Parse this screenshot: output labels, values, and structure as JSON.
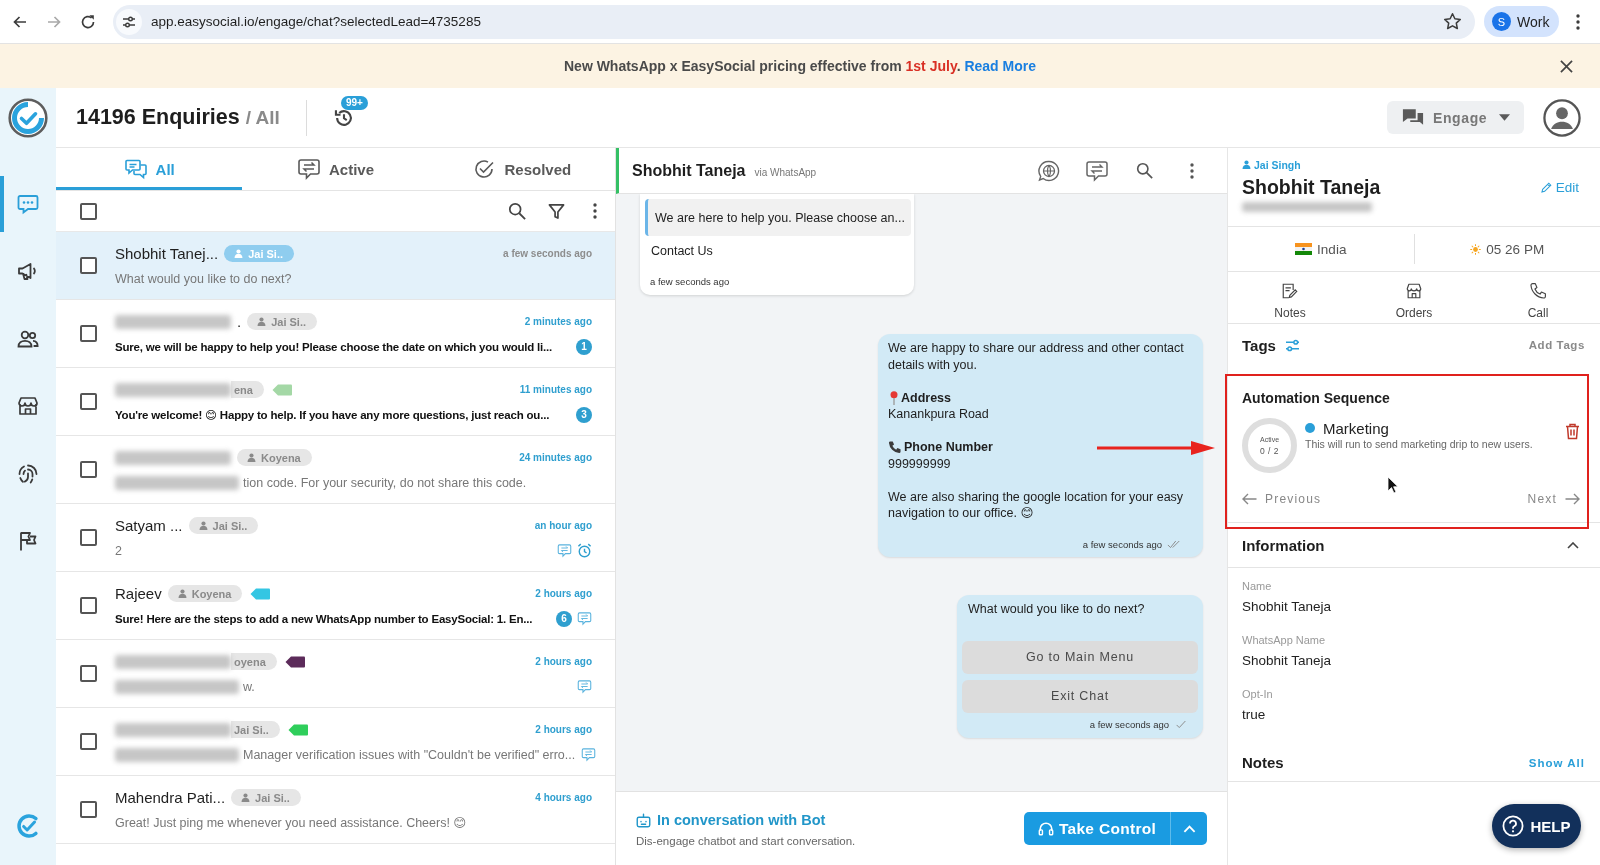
{
  "browser": {
    "url": "app.easysocial.io/engage/chat?selectedLead=4735285",
    "profile_initial": "S",
    "profile_name": "Work"
  },
  "banner": {
    "text": "New WhatsApp x EasySocial pricing effective from",
    "highlight": "1st July",
    "end": ".",
    "link": "Read More"
  },
  "rail": {
    "items": [
      {
        "kind": "chat",
        "selected": true
      },
      {
        "kind": "megaphone",
        "selected": false
      },
      {
        "kind": "people",
        "selected": false
      },
      {
        "kind": "store",
        "selected": false
      },
      {
        "kind": "fingerprint",
        "selected": false
      },
      {
        "kind": "flag",
        "selected": false
      }
    ]
  },
  "header": {
    "title": "14196 Enquiries",
    "scope": "/ All",
    "history_badge": "99+",
    "engage": "Engage"
  },
  "tabs": [
    {
      "kind": "all",
      "label": "All",
      "selected": true
    },
    {
      "kind": "active",
      "label": "Active",
      "selected": false
    },
    {
      "kind": "resolved",
      "label": "Resolved",
      "selected": false
    }
  ],
  "list_toolbar": {
    "select_all": {
      "checked": false
    }
  },
  "conversations": [
    {
      "name": "Shobhit Tanej...",
      "name_redacted": false,
      "agent": "Jai Si..",
      "agent_icon": true,
      "time": "a few seconds ago",
      "preview": "What would you like to do next?",
      "preview_redacted": false,
      "unread": false,
      "checked": false,
      "selected": true
    },
    {
      "name": ".",
      "name_redacted": true,
      "agent": "Jai Si..",
      "agent_icon": true,
      "time": "2 minutes ago",
      "preview": "Sure, we will be happy to help you! Please choose the date on which you would li...",
      "preview_redacted": false,
      "unread": true,
      "badge": "1",
      "checked": false,
      "selected": false
    },
    {
      "name_redacted": true,
      "agent": "ena",
      "agent_icon": false,
      "tag": {
        "color": "#a4d8a6"
      },
      "time": "11 minutes ago",
      "preview": "You're welcome! 😊 Happy to help. If you have any more questions, just reach ou...",
      "preview_redacted": false,
      "unread": true,
      "badge": "3",
      "checked": false,
      "selected": false
    },
    {
      "name_redacted": true,
      "agent": "Koyena",
      "agent_icon": true,
      "time": "24 minutes ago",
      "preview": "tion code. For your security, do not share this code.",
      "preview_redacted": true,
      "unread": false,
      "checked": false,
      "selected": false
    },
    {
      "name": "Satyam ...",
      "name_redacted": false,
      "agent": "Jai Si..",
      "agent_icon": true,
      "time": "an hour ago",
      "preview": "2",
      "preview_redacted": false,
      "unread": false,
      "status_icons": [
        {
          "kind": "chat"
        },
        {
          "kind": "alarm"
        }
      ],
      "checked": false,
      "selected": false
    },
    {
      "name": "Rajeev",
      "name_redacted": false,
      "agent": "Koyena",
      "agent_icon": true,
      "tag": {
        "color": "#34c6e3"
      },
      "time": "2 hours ago",
      "preview": "Sure! Here are the steps to add a new WhatsApp number to EasySocial: 1. En...",
      "preview_redacted": false,
      "unread": true,
      "badge": "6",
      "status_icons": [
        {
          "kind": "chat"
        }
      ],
      "checked": false,
      "selected": false
    },
    {
      "name_redacted": true,
      "agent": "oyena",
      "agent_icon": false,
      "tag": {
        "color": "#5c2b5a"
      },
      "time": "2 hours ago",
      "preview": "w.",
      "preview_redacted": true,
      "unread": false,
      "status_icons": [
        {
          "kind": "chat"
        }
      ],
      "checked": false,
      "selected": false
    },
    {
      "name_redacted": true,
      "agent": "Jai Si..",
      "agent_icon": false,
      "tag": {
        "color": "#2fce5b"
      },
      "time": "2 hours ago",
      "preview": "Manager verification issues with \"Couldn't be verified\" erro...",
      "preview_redacted": true,
      "unread": false,
      "status_icons": [
        {
          "kind": "chat"
        }
      ],
      "checked": false,
      "selected": false
    },
    {
      "name": "Mahendra Pati...",
      "name_redacted": false,
      "agent": "Jai Si..",
      "agent_icon": true,
      "time": "4 hours ago",
      "preview": "Great! Just ping me whenever you need assistance. Cheers! 😊",
      "preview_redacted": false,
      "unread": false,
      "checked": false,
      "selected": false
    }
  ],
  "chat": {
    "contact": "Shobhit Taneja",
    "channel": "via WhatsApp",
    "messages": [
      {
        "kind": "incoming",
        "quote": "We are here to help you. Please choose an...",
        "text": "Contact Us",
        "time": "a few seconds ago"
      },
      {
        "kind": "outgoing",
        "paragraphs": [
          {
            "kind": "text",
            "text": "We are happy to share our address and other contact details with you."
          },
          {
            "kind": "location",
            "title": "Address",
            "text": "Kanankpura Road"
          },
          {
            "kind": "phone",
            "title": "Phone Number",
            "text": "999999999"
          },
          {
            "kind": "text",
            "text": "We are also sharing the google location for your easy navigation to our office. 😊"
          }
        ],
        "time": "a few seconds ago",
        "delivered": true
      },
      {
        "kind": "outgoing",
        "paragraphs": [
          {
            "kind": "text",
            "text": "What would you like to do next?"
          }
        ],
        "buttons": [
          "Go to Main Menu",
          "Exit Chat"
        ],
        "time": "a few seconds ago",
        "delivered": false
      }
    ],
    "bot_status": {
      "title": "In conversation with Bot",
      "subtitle": "Dis-engage chatbot and start conversation.",
      "button": "Take Control"
    }
  },
  "contact": {
    "owner": "Jai Singh",
    "name": "Shobhit Taneja",
    "edit": "Edit",
    "phone_redacted": true,
    "country": "India",
    "local_time": "05 26 PM",
    "actions": [
      {
        "kind": "notes",
        "label": "Notes"
      },
      {
        "kind": "orders",
        "label": "Orders"
      },
      {
        "kind": "call",
        "label": "Call"
      }
    ],
    "tags": {
      "title": "Tags",
      "add": "Add Tags"
    },
    "automation": {
      "title": "Automation Sequence",
      "ring": {
        "label": "Active",
        "count": "0 / 2"
      },
      "sequence": {
        "name": "Marketing",
        "description": "This will run to send marketing drip to new users."
      },
      "previous": "Previous",
      "next": "Next"
    },
    "information": {
      "title": "Information",
      "expanded": true,
      "fields": [
        {
          "label": "Name",
          "value": "Shobhit Taneja"
        },
        {
          "label": "WhatsApp Name",
          "value": "Shobhit Taneja"
        },
        {
          "label": "Opt-In",
          "value": "true"
        }
      ]
    },
    "notes": {
      "title": "Notes",
      "show_all": "Show All"
    }
  },
  "help": {
    "label": "HELP"
  }
}
